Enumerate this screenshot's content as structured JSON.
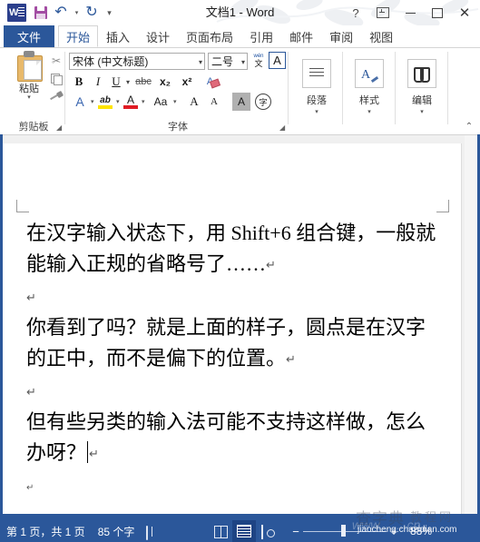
{
  "window": {
    "title": "文档1 - Word",
    "logo_icon": "word-logo-icon",
    "quick_access": [
      {
        "name": "save-icon",
        "label": "保存"
      },
      {
        "name": "undo-icon",
        "label": "撤消",
        "glyph": "↶"
      },
      {
        "name": "undo-dropdown-icon",
        "glyph": "▾"
      },
      {
        "name": "redo-icon",
        "label": "恢复",
        "glyph": "↻"
      },
      {
        "name": "customize-qat-icon",
        "glyph": "▾"
      }
    ],
    "controls": {
      "help": "?",
      "ribbon_display": "ribbon-display-options-icon",
      "minimize": "minimize-icon",
      "maximize": "maximize-icon",
      "close": "✕"
    }
  },
  "ribbon": {
    "file_tab": "文件",
    "tabs": [
      {
        "label": "开始",
        "active": true
      },
      {
        "label": "插入",
        "active": false
      },
      {
        "label": "设计",
        "active": false
      },
      {
        "label": "页面布局",
        "active": false
      },
      {
        "label": "引用",
        "active": false
      },
      {
        "label": "邮件",
        "active": false
      },
      {
        "label": "审阅",
        "active": false
      },
      {
        "label": "视图",
        "active": false
      }
    ],
    "collapse_glyph": "⌃",
    "groups": {
      "clipboard": {
        "label": "剪贴板",
        "paste_label": "粘贴",
        "paste_caret": "▾",
        "cut_label": "剪切",
        "copy_label": "复制",
        "format_painter_label": "格式刷",
        "launcher": "◢"
      },
      "font": {
        "label": "字体",
        "font_name_value": "宋体 (中文标题)",
        "font_name_caret": "▾",
        "font_size_value": "二号",
        "font_size_caret": "▾",
        "phonetic_top": "wén",
        "phonetic_bottom": "文",
        "char_border": "A",
        "bold": "B",
        "italic": "I",
        "underline": "U",
        "underline_caret": "▾",
        "strikethrough": "abc",
        "subscript": "x₂",
        "superscript": "x²",
        "clear_format_label": "清除格式",
        "text_effect": "A",
        "text_effect_caret": "▾",
        "highlight_ab": "ab",
        "highlight_caret": "▾",
        "font_color_a": "A",
        "font_color_caret": "▾",
        "change_case": "Aa",
        "change_case_caret": "▾",
        "grow_font": "A",
        "shrink_font": "A",
        "char_shading": "A",
        "enclose_char": "字",
        "launcher": "◢"
      },
      "paragraph": {
        "label": "段落",
        "caret": "▾",
        "icon": "align-lines-icon"
      },
      "styles": {
        "label": "样式",
        "caret": "▾",
        "icon": "styles-brush-icon"
      },
      "editing": {
        "label": "编辑",
        "caret": "▾",
        "icon": "binoculars-icon"
      }
    }
  },
  "document": {
    "paragraphs": [
      {
        "text": "在汉字输入状态下，用 Shift+6 组合键，一般就能输入正规的省略号了……",
        "mark": "↵",
        "empty": false
      },
      {
        "text": "",
        "mark": "↵",
        "empty": true
      },
      {
        "text": "你看到了吗？就是上面的样子，圆点是在汉字的正中，而不是偏下的位置。",
        "mark": "↵",
        "empty": false
      },
      {
        "text": "",
        "mark": "↵",
        "empty": true
      },
      {
        "text": "但有些另类的输入法可能不支持这样做，怎么办呀？",
        "mark": "↵",
        "empty": false,
        "caret_after": true
      },
      {
        "text": "",
        "mark": "↵",
        "empty": true
      }
    ]
  },
  "status_bar": {
    "page_info": "第 1 页，共 1 页",
    "word_count": "85 个字",
    "proofing_icon": "proofing-language-icon",
    "views": [
      {
        "name": "read-mode-view",
        "label": "阅读视图",
        "active": false
      },
      {
        "name": "print-layout-view",
        "label": "页面视图",
        "active": true
      },
      {
        "name": "web-layout-view",
        "label": "Web 版式视图",
        "active": false
      }
    ],
    "zoom_out": "−",
    "zoom_in": "+",
    "zoom_value": "88%"
  },
  "watermark": {
    "site_cn": "查字典",
    "site_cn2": "教程网",
    "url": "jiaocheng.chazidian.com",
    "faint": "www........cn"
  },
  "colors": {
    "accent": "#2b579a",
    "accent_dark": "#1e4484",
    "highlight_yellow": "#ffe400",
    "font_red": "#e01b24",
    "save_purple": "#a34da3"
  }
}
